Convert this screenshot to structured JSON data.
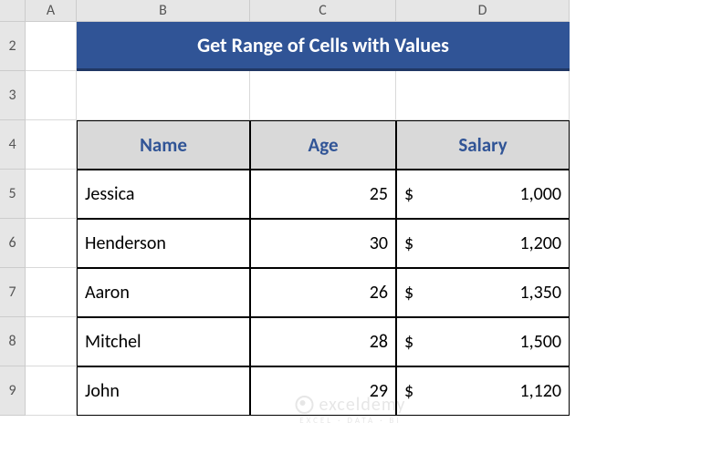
{
  "columns": [
    "A",
    "B",
    "C",
    "D"
  ],
  "rows": [
    "2",
    "3",
    "4",
    "5",
    "6",
    "7",
    "8",
    "9"
  ],
  "title": "Get Range of Cells with Values",
  "headers": {
    "name": "Name",
    "age": "Age",
    "salary": "Salary"
  },
  "currency": "$",
  "data": [
    {
      "name": "Jessica",
      "age": "25",
      "salary": "1,000"
    },
    {
      "name": "Henderson",
      "age": "30",
      "salary": "1,200"
    },
    {
      "name": "Aaron",
      "age": "26",
      "salary": "1,350"
    },
    {
      "name": "Mitchel",
      "age": "28",
      "salary": "1,500"
    },
    {
      "name": "John",
      "age": "29",
      "salary": "1,120"
    }
  ],
  "watermark": {
    "brand": "exceldemy",
    "tag": "EXCEL · DATA · BI"
  },
  "chart_data": {
    "type": "table",
    "title": "Get Range of Cells with Values",
    "columns": [
      "Name",
      "Age",
      "Salary"
    ],
    "rows": [
      [
        "Jessica",
        25,
        1000
      ],
      [
        "Henderson",
        30,
        1200
      ],
      [
        "Aaron",
        26,
        1350
      ],
      [
        "Mitchel",
        28,
        1500
      ],
      [
        "John",
        29,
        1120
      ]
    ],
    "currency": "$"
  }
}
